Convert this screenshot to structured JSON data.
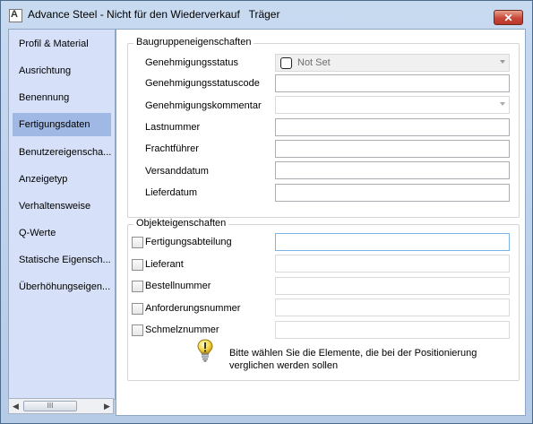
{
  "window": {
    "title": "Advance Steel - Nicht für den Wiederverkauf   Träger",
    "close_label": "✕"
  },
  "sidebar": {
    "items": [
      {
        "label": "Profil & Material"
      },
      {
        "label": "Ausrichtung"
      },
      {
        "label": "Benennung"
      },
      {
        "label": "Fertigungsdaten",
        "selected": true
      },
      {
        "label": "Benutzereigenscha..."
      },
      {
        "label": "Anzeigetyp"
      },
      {
        "label": "Verhaltensweise"
      },
      {
        "label": "Q-Werte"
      },
      {
        "label": "Statische Eigensch..."
      },
      {
        "label": "Überhöhungseigen..."
      }
    ],
    "scrollbar": {
      "left_arrow": "◀",
      "right_arrow": "▶",
      "thumb_grip": "III"
    }
  },
  "assembly": {
    "title": "Baugruppeneigenschaften",
    "status_label": "Genehmigungsstatus",
    "status_value": "Not Set",
    "statuscode_label": "Genehmigungsstatuscode",
    "statuscode_value": "",
    "comment_label": "Genehmigungskommentar",
    "comment_value": "",
    "load_label": "Lastnummer",
    "load_value": "",
    "carrier_label": "Frachtführer",
    "carrier_value": "",
    "shipdate_label": "Versanddatum",
    "shipdate_value": "",
    "deliverydate_label": "Lieferdatum",
    "deliverydate_value": ""
  },
  "object": {
    "title": "Objekteigenschaften",
    "fields": [
      {
        "label": "Fertigungsabteilung",
        "value": "",
        "checked": false
      },
      {
        "label": "Lieferant",
        "value": "",
        "checked": false
      },
      {
        "label": "Bestellnummer",
        "value": "",
        "checked": false
      },
      {
        "label": "Anforderungsnummer",
        "value": "",
        "checked": false
      },
      {
        "label": "Schmelznummer",
        "value": "",
        "checked": false
      }
    ],
    "hint": "Bitte wählen Sie die Elemente, die bei der Positionierung verglichen werden sollen"
  },
  "colors": {
    "title_bg": "#c2d6ee",
    "sidebar_bg": "#d6e0f8",
    "selected_item": "#9fb8e4",
    "close_button": "#c8483a"
  }
}
